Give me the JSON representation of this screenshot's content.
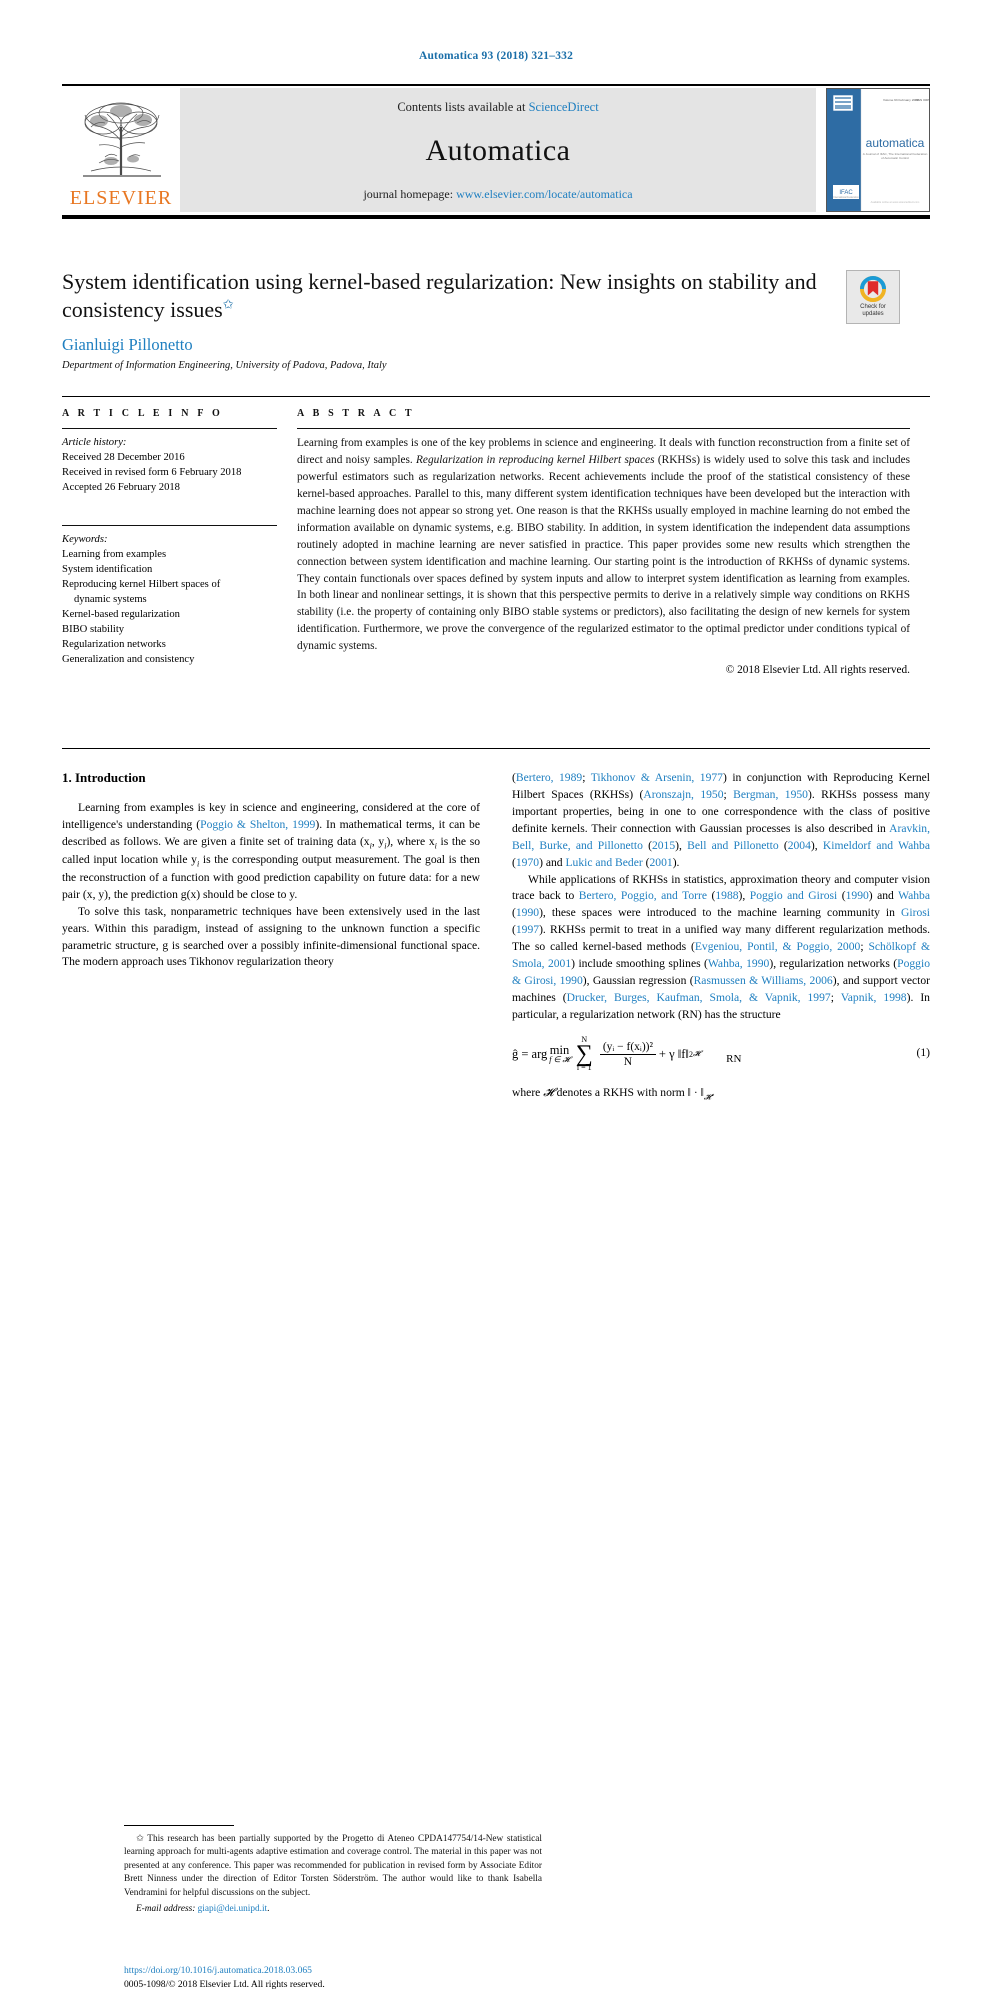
{
  "running_head": "Automatica 93 (2018) 321–332",
  "masthead": {
    "publisher": "ELSEVIER",
    "contents_prefix": "Contents lists available at ",
    "contents_link": "ScienceDirect",
    "journal_name": "Automatica",
    "homepage_prefix": "journal homepage: ",
    "homepage_link": "www.elsevier.com/locate/automatica",
    "cover": {
      "journal_word": "automatica",
      "tagline": "A Journal of IFAC, The International Federation of Automatic Control",
      "volume_line": "Volume 93  February 2018   ISSN 0005-1098",
      "ifac_badge": "IFAC"
    }
  },
  "title": {
    "text": "System identification using kernel-based regularization: New insights on stability and consistency issues",
    "footnote_marker": "✩",
    "author": "Gianluigi Pillonetto",
    "affiliation": "Department of Information Engineering, University of Padova, Padova, Italy",
    "crossmark_line1": "Check for",
    "crossmark_line2": "updates"
  },
  "article_info": {
    "heading": "A R T I C L E   I N F O",
    "history_label": "Article history:",
    "history": [
      "Received 28 December 2016",
      "Received in revised form 6 February 2018",
      "Accepted 26 February 2018"
    ],
    "keywords_label": "Keywords:",
    "keywords": [
      "Learning from examples",
      "System identification",
      "Reproducing kernel Hilbert spaces of",
      "dynamic systems",
      "Kernel-based regularization",
      "BIBO stability",
      "Regularization networks",
      "Generalization and consistency"
    ]
  },
  "abstract": {
    "heading": "A B S T R A C T",
    "paragraph_part1": "Learning from examples is one of the key problems in science and engineering. It deals with function reconstruction from a finite set of direct and noisy samples. ",
    "italic_part": "Regularization in reproducing kernel Hilbert spaces",
    "paragraph_part2": " (RKHSs) is widely used to solve this task and includes powerful estimators such as regularization networks. Recent achievements include the proof of the statistical consistency of these kernel-based approaches. Parallel to this, many different system identification techniques have been developed but the interaction with machine learning does not appear so strong yet. One reason is that the RKHSs usually employed in machine learning do not embed the information available on dynamic systems, e.g. BIBO stability. In addition, in system identification the independent data assumptions routinely adopted in machine learning are never satisfied in practice. This paper provides some new results which strengthen the connection between system identification and machine learning. Our starting point is the introduction of RKHSs of dynamic systems. They contain functionals over spaces defined by system inputs and allow to interpret system identification as learning from examples. In both linear and nonlinear settings, it is shown that this perspective permits to derive in a relatively simple way conditions on RKHS stability (i.e. the property of containing only BIBO stable systems or predictors), also facilitating the design of new kernels for system identification. Furthermore, we prove the convergence of the regularized estimator to the optimal predictor under conditions typical of dynamic systems.",
    "copyright": "© 2018 Elsevier Ltd. All rights reserved."
  },
  "body": {
    "section_heading": "1. Introduction",
    "left_paragraph_1_a": "Learning from examples is key in science and engineering, considered at the core of intelligence's understanding (",
    "left_ref_1": "Poggio & Shelton, 1999",
    "left_paragraph_1_b": "). In mathematical terms, it can be described as follows. We are given a finite set of training data (x",
    "left_paragraph_1_c": ", y",
    "left_paragraph_1_d": "), where x",
    "left_paragraph_1_e": " is the so called input location while y",
    "left_paragraph_1_f": " is the corresponding output measurement. The goal is then the reconstruction of a function with good prediction capability on future data: for a new pair (x, y), the prediction g(x) should be close to y.",
    "left_paragraph_2": "To solve this task, nonparametric techniques have been extensively used in the last years. Within this paradigm, instead of assigning to the unknown function a specific parametric structure, g is searched over a possibly infinite-dimensional functional space. The modern approach uses Tikhonov regularization theory",
    "right_p1_refs_a": "Bertero, 1989",
    "right_p1_sep1": "; ",
    "right_p1_refs_b": "Tikhonov & Arsenin, 1977",
    "right_p1_text_a": ") in conjunction with Reproducing Kernel Hilbert Spaces (RKHSs) (",
    "right_p1_refs_c": "Aronszajn, 1950",
    "right_p1_sep2": "; ",
    "right_p1_refs_d": "Bergman, 1950",
    "right_p1_text_b": "). RKHSs possess many important properties, being in one to one correspondence with the class of positive definite kernels. Their connection with Gaussian processes is also described in ",
    "right_p1_refs_e": "Aravkin, Bell, Burke, and Pillonetto",
    "right_p1_refs_f": "2015",
    "right_p1_refs_g": "Bell and Pillonetto",
    "right_p1_refs_h": "2004",
    "right_p1_refs_i": "Kimeldorf and Wahba",
    "right_p1_refs_j": "1970",
    "right_p1_refs_k": "Lukic and Beder",
    "right_p1_refs_l": "2001",
    "right_p2_text_a": "While applications of RKHSs in statistics, approximation theory and computer vision trace back to ",
    "right_p2_refs_a": "Bertero, Poggio, and Torre",
    "right_p2_refs_b": "1988",
    "right_p2_refs_c": "Poggio and Girosi",
    "right_p2_refs_d": "1990",
    "right_p2_refs_e": "Wahba",
    "right_p2_refs_f": "1990",
    "right_p2_text_b": "), these spaces were introduced to the machine learning community in ",
    "right_p2_refs_g": "Girosi",
    "right_p2_refs_h": "1997",
    "right_p2_text_c": "). RKHSs permit to treat in a unified way many different regularization methods. The so called kernel-based methods (",
    "right_p2_refs_i": "Evgeniou, Pontil, & Poggio, 2000",
    "right_p2_refs_j": "Schölkopf & Smola, 2001",
    "right_p2_text_d": ") include smoothing splines (",
    "right_p2_refs_k": "Wahba, 1990",
    "right_p2_text_e": "), regularization networks (",
    "right_p2_refs_l": "Poggio & Girosi, 1990",
    "right_p2_text_f": "), Gaussian regression (",
    "right_p2_refs_m": "Rasmussen & Williams, 2006",
    "right_p2_text_g": "), and support vector machines (",
    "right_p2_refs_n": "Drucker, Burges, Kaufman, Smola, & Vapnik, 1997",
    "right_p2_refs_o": "Vapnik, 1998",
    "right_p2_text_h": "). In particular, a regularization network (RN) has the structure"
  },
  "equation": {
    "lhs": "ĝ = arg",
    "min": "min",
    "min_sub": "f ∈ 𝓗",
    "sum_upper": "N",
    "sum_lower": "i = 1",
    "numerator": "(yᵢ − f(xᵢ))²",
    "denominator": "N",
    "plus_term": "+ γ ‖f‖",
    "norm_sup": "2",
    "norm_sub": "𝓗",
    "name": "RN",
    "number": "(1)",
    "following_text_a": "where ",
    "following_script": "𝓗",
    "following_text_b": " denotes a RKHS with norm ‖ · ‖",
    "following_sub": "𝓗",
    "following_text_c": "."
  },
  "footnote": {
    "marker": "✩",
    "text": "This research has been partially supported by the Progetto di Ateneo CPDA147754/14-New statistical learning approach for multi-agents adaptive estimation and coverage control. The material in this paper was not presented at any conference. This paper was recommended for publication in revised form by Associate Editor Brett Ninness under the direction of Editor Torsten Söderström. The author would like to thank Isabella Vendramini for helpful discussions on the subject.",
    "email_label": "E-mail address:",
    "email": "giapi@dei.unipd.it",
    "email_end": "."
  },
  "doi_block": {
    "doi": "https://doi.org/10.1016/j.automatica.2018.03.065",
    "issn_line": "0005-1098/© 2018 Elsevier Ltd. All rights reserved."
  },
  "colors": {
    "link": "#1f7fc0",
    "elsevier_orange": "#e87722",
    "cover_blue": "#2e6ca4"
  }
}
